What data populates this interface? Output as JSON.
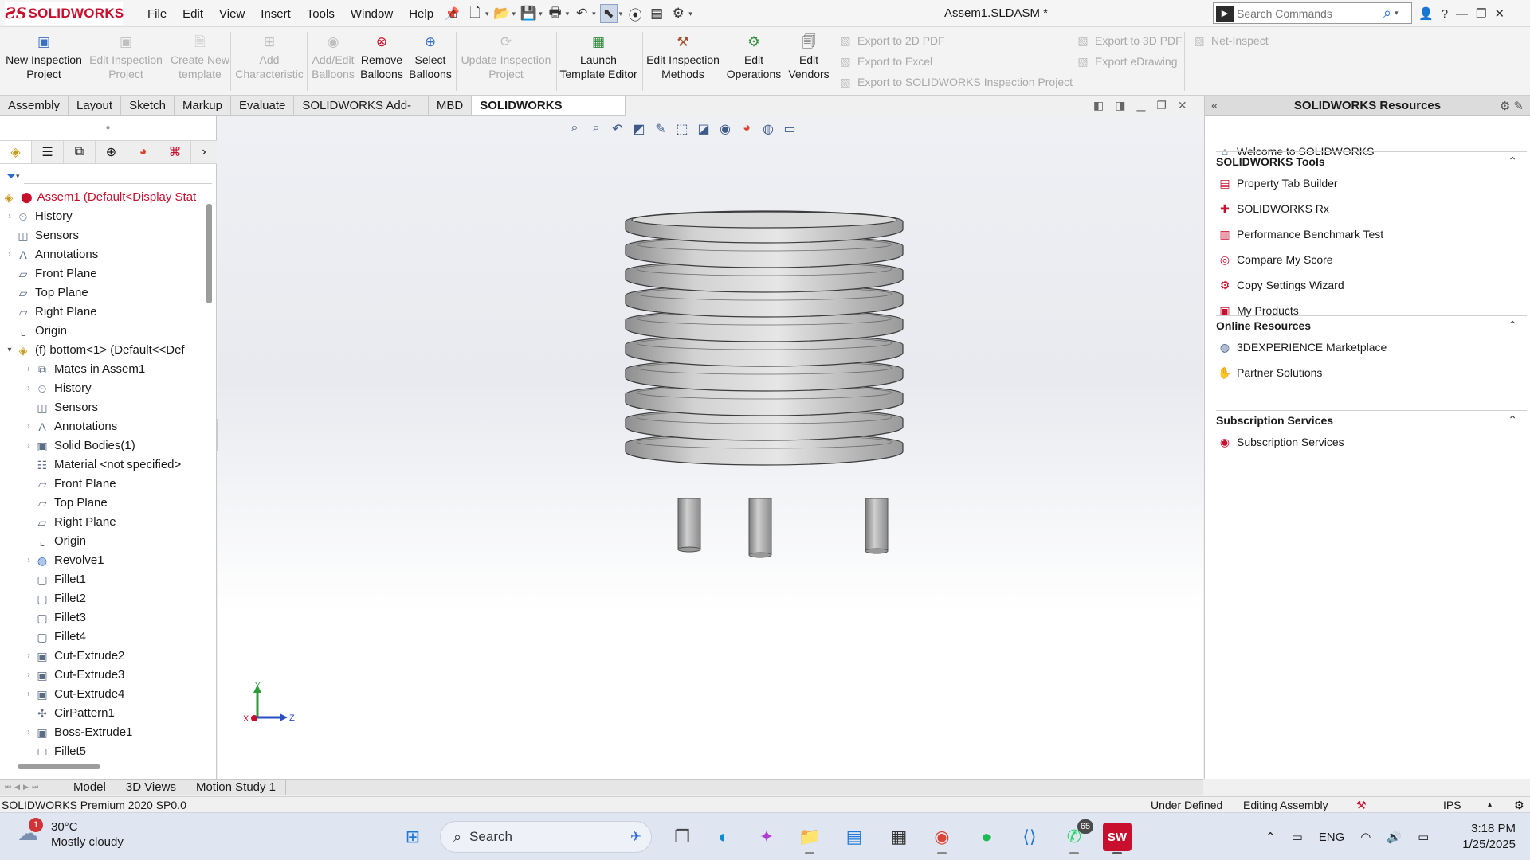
{
  "app": {
    "logo_text": "SOLIDWORKS",
    "doc_title": "Assem1.SLDASM *",
    "menus": [
      "File",
      "Edit",
      "View",
      "Insert",
      "Tools",
      "Window",
      "Help"
    ],
    "search_placeholder": "Search Commands"
  },
  "toolbar": {
    "tools": [
      {
        "l1": "New Inspection",
        "l2": "Project",
        "enabled": true,
        "icon": "new-project-icon"
      },
      {
        "l1": "Edit Inspection",
        "l2": "Project",
        "enabled": false,
        "icon": "edit-project-icon"
      },
      {
        "l1": "Create New",
        "l2": "template",
        "enabled": false,
        "icon": "template-icon"
      },
      {
        "l1": "Add",
        "l2": "Characteristic",
        "enabled": false,
        "icon": "characteristic-icon"
      },
      {
        "l1": "Add/Edit",
        "l2": "Balloons",
        "enabled": false,
        "icon": "balloon-icon"
      },
      {
        "l1": "Remove",
        "l2": "Balloons",
        "enabled": true,
        "icon": "remove-balloon-icon"
      },
      {
        "l1": "Select",
        "l2": "Balloons",
        "enabled": true,
        "icon": "select-balloon-icon"
      },
      {
        "l1": "Update Inspection",
        "l2": "Project",
        "enabled": false,
        "icon": "update-icon"
      },
      {
        "l1": "Launch",
        "l2": "Template Editor",
        "enabled": true,
        "icon": "template-editor-icon"
      },
      {
        "l1": "Edit Inspection",
        "l2": "Methods",
        "enabled": true,
        "icon": "methods-icon"
      },
      {
        "l1": "Edit",
        "l2": "Operations",
        "enabled": true,
        "icon": "operations-icon"
      },
      {
        "l1": "Edit",
        "l2": "Vendors",
        "enabled": true,
        "icon": "vendors-icon"
      }
    ],
    "exports": [
      "Export to 2D PDF",
      "Export to Excel",
      "Export to SOLIDWORKS Inspection Project",
      "Export to 3D PDF",
      "Export eDrawing",
      "Net-Inspect"
    ]
  },
  "tabs": {
    "items": [
      "Assembly",
      "Layout",
      "Sketch",
      "Markup",
      "Evaluate",
      "SOLIDWORKS Add-Ins",
      "MBD",
      "SOLIDWORKS Inspection"
    ],
    "active_index": 7
  },
  "tree": {
    "root": "Assem1  (Default<Display Stat",
    "nodes": [
      {
        "label": "History",
        "level": 0,
        "expand": true,
        "icon": "history-icon"
      },
      {
        "label": "Sensors",
        "level": 0,
        "expand": false,
        "icon": "sensor-icon"
      },
      {
        "label": "Annotations",
        "level": 0,
        "expand": true,
        "icon": "annotation-icon"
      },
      {
        "label": "Front Plane",
        "level": 0,
        "expand": false,
        "icon": "plane-icon"
      },
      {
        "label": "Top Plane",
        "level": 0,
        "expand": false,
        "icon": "plane-icon"
      },
      {
        "label": "Right Plane",
        "level": 0,
        "expand": false,
        "icon": "plane-icon"
      },
      {
        "label": "Origin",
        "level": 0,
        "expand": false,
        "icon": "origin-icon"
      },
      {
        "label": "(f) bottom<1> (Default<<Def",
        "level": 0,
        "expand": true,
        "icon": "part-icon"
      },
      {
        "label": "Mates in Assem1",
        "level": 1,
        "expand": true,
        "icon": "mates-icon"
      },
      {
        "label": "History",
        "level": 1,
        "expand": true,
        "icon": "history-icon"
      },
      {
        "label": "Sensors",
        "level": 1,
        "expand": false,
        "icon": "sensor-icon"
      },
      {
        "label": "Annotations",
        "level": 1,
        "expand": true,
        "icon": "annotation-icon"
      },
      {
        "label": "Solid Bodies(1)",
        "level": 1,
        "expand": true,
        "icon": "solid-bodies-icon"
      },
      {
        "label": "Material <not specified>",
        "level": 1,
        "expand": false,
        "icon": "material-icon"
      },
      {
        "label": "Front Plane",
        "level": 1,
        "expand": false,
        "icon": "plane-icon"
      },
      {
        "label": "Top Plane",
        "level": 1,
        "expand": false,
        "icon": "plane-icon"
      },
      {
        "label": "Right Plane",
        "level": 1,
        "expand": false,
        "icon": "plane-icon"
      },
      {
        "label": "Origin",
        "level": 1,
        "expand": false,
        "icon": "origin-icon"
      },
      {
        "label": "Revolve1",
        "level": 1,
        "expand": true,
        "icon": "revolve-icon"
      },
      {
        "label": "Fillet1",
        "level": 1,
        "expand": false,
        "icon": "fillet-icon"
      },
      {
        "label": "Fillet2",
        "level": 1,
        "expand": false,
        "icon": "fillet-icon"
      },
      {
        "label": "Fillet3",
        "level": 1,
        "expand": false,
        "icon": "fillet-icon"
      },
      {
        "label": "Fillet4",
        "level": 1,
        "expand": false,
        "icon": "fillet-icon"
      },
      {
        "label": "Cut-Extrude2",
        "level": 1,
        "expand": true,
        "icon": "cut-extrude-icon"
      },
      {
        "label": "Cut-Extrude3",
        "level": 1,
        "expand": true,
        "icon": "cut-extrude-icon"
      },
      {
        "label": "Cut-Extrude4",
        "level": 1,
        "expand": true,
        "icon": "cut-extrude-icon"
      },
      {
        "label": "CirPattern1",
        "level": 1,
        "expand": false,
        "icon": "circular-pattern-icon"
      },
      {
        "label": "Boss-Extrude1",
        "level": 1,
        "expand": true,
        "icon": "boss-extrude-icon"
      },
      {
        "label": "Fillet5",
        "level": 1,
        "expand": false,
        "icon": "fillet-icon"
      }
    ]
  },
  "triad": {
    "x": "X",
    "y": "Y",
    "z": "Z"
  },
  "resources": {
    "title": "SOLIDWORKS Resources",
    "welcome": "Welcome to SOLIDWORKS",
    "sections": [
      {
        "title": "SOLIDWORKS Tools",
        "items": [
          "Property Tab Builder",
          "SOLIDWORKS Rx",
          "Performance Benchmark Test",
          "Compare My Score",
          "Copy Settings Wizard",
          "My Products"
        ]
      },
      {
        "title": "Online Resources",
        "items": [
          "3DEXPERIENCE Marketplace",
          "Partner Solutions"
        ]
      },
      {
        "title": "Subscription Services",
        "items": [
          "Subscription Services"
        ]
      }
    ]
  },
  "bottom_tabs": {
    "items": [
      "Model",
      "3D Views",
      "Motion Study 1"
    ],
    "active_index": 0
  },
  "status": {
    "product": "SOLIDWORKS Premium 2020 SP0.0",
    "definition": "Under Defined",
    "mode": "Editing Assembly",
    "units": "IPS"
  },
  "taskbar": {
    "weather_badge": "1",
    "temp": "30°C",
    "condition": "Mostly cloudy",
    "search": "Search",
    "whatsapp_badge": "65",
    "lang": "ENG",
    "time": "3:18 PM",
    "date": "1/25/2025"
  },
  "colors": {
    "brand": "#c8102e",
    "accent": "#2a6bd6"
  }
}
